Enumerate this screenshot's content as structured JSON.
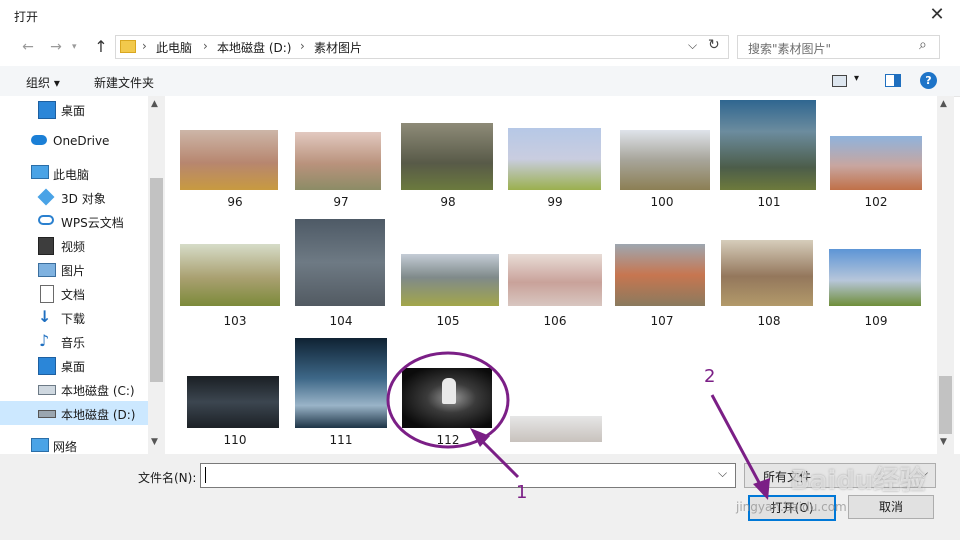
{
  "window": {
    "title": "打开",
    "close_glyph": "✕"
  },
  "nav": {
    "back_glyph": "←",
    "forward_glyph": "→",
    "up_glyph": "↑",
    "breadcrumb": [
      "此电脑",
      "本地磁盘 (D:)",
      "素材图片"
    ],
    "breadcrumb_sep": "›",
    "dropdown_glyph": "⌵",
    "refresh_glyph": "↻",
    "search_placeholder": "搜索\"素材图片\"",
    "search_glyph": "⌕"
  },
  "toolbar": {
    "organize": "组织 ▾",
    "new_folder": "新建文件夹",
    "view_glyph": "▾",
    "help_glyph": "?"
  },
  "sidebar": {
    "items": [
      {
        "label": "桌面",
        "icon": "desktop-icon"
      },
      {
        "label": "OneDrive",
        "icon": "cloud-icon"
      },
      {
        "label": "此电脑",
        "icon": "computer-icon"
      },
      {
        "label": "3D 对象",
        "icon": "cube-icon"
      },
      {
        "label": "WPS云文档",
        "icon": "cloud-doc-icon"
      },
      {
        "label": "视频",
        "icon": "video-icon"
      },
      {
        "label": "图片",
        "icon": "picture-icon"
      },
      {
        "label": "文档",
        "icon": "document-icon"
      },
      {
        "label": "下载",
        "icon": "download-icon"
      },
      {
        "label": "音乐",
        "icon": "music-icon"
      },
      {
        "label": "桌面",
        "icon": "desktop-icon"
      },
      {
        "label": "本地磁盘 (C:)",
        "icon": "drive-icon"
      },
      {
        "label": "本地磁盘 (D:)",
        "icon": "drive-icon"
      },
      {
        "label": "网络",
        "icon": "network-icon"
      }
    ]
  },
  "files": {
    "labels": [
      "96",
      "97",
      "98",
      "99",
      "100",
      "101",
      "102",
      "103",
      "104",
      "105",
      "106",
      "107",
      "108",
      "109",
      "110",
      "111",
      "112"
    ]
  },
  "footer": {
    "filename_label": "文件名(N):",
    "filename_value": "",
    "filter_value": "所有文件",
    "open_button": "打开(O)",
    "cancel_button": "取消"
  },
  "annotations": {
    "marker1": "1",
    "marker2": "2",
    "watermark": "Baidu经验",
    "watermark_url": "jingyan.baidu.com"
  },
  "colors": {
    "accent": "#0078d7",
    "selection": "#cce8ff",
    "annotation": "#7b1f86"
  }
}
